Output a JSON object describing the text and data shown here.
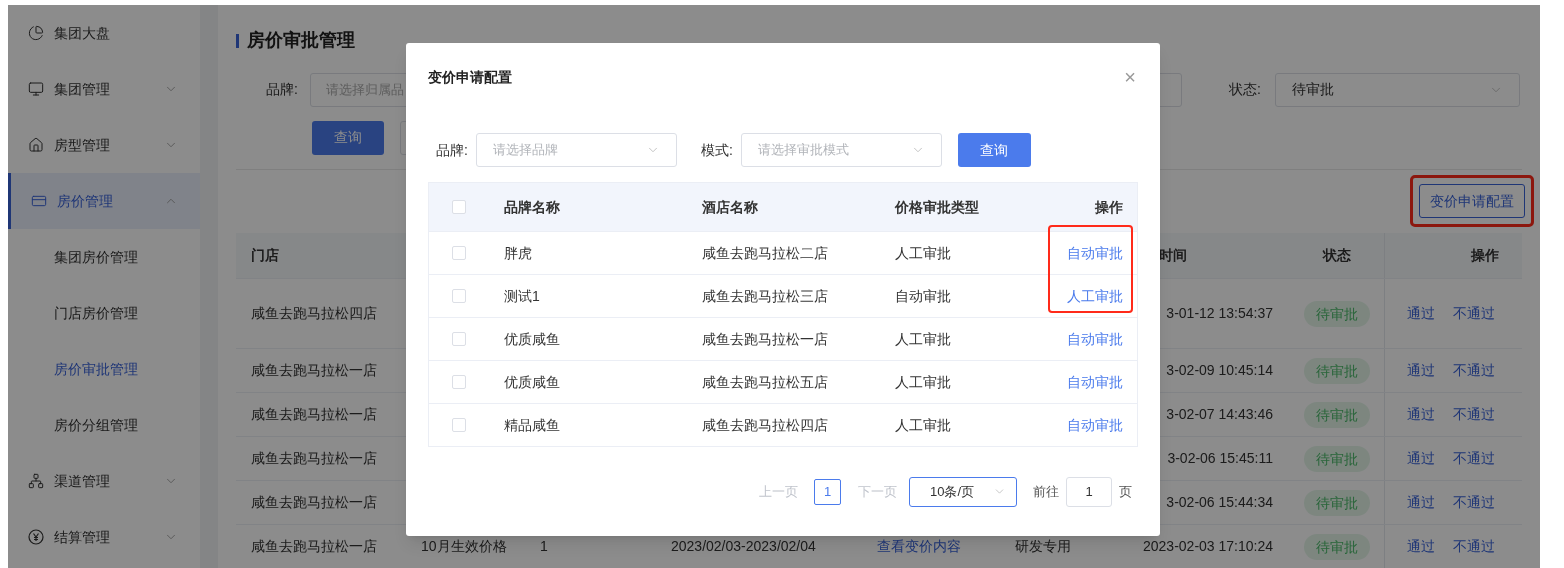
{
  "sidebar": {
    "items": [
      {
        "label": "集团大盘",
        "kind": "link",
        "selected": false
      },
      {
        "label": "集团管理",
        "kind": "group",
        "selected": false,
        "expanded": false
      },
      {
        "label": "房型管理",
        "kind": "group",
        "selected": false,
        "expanded": false
      },
      {
        "label": "房价管理",
        "kind": "group",
        "selected": true,
        "expanded": true,
        "children": [
          {
            "label": "集团房价管理",
            "selected": false
          },
          {
            "label": "门店房价管理",
            "selected": false
          },
          {
            "label": "房价审批管理",
            "selected": true
          },
          {
            "label": "房价分组管理",
            "selected": false
          }
        ]
      },
      {
        "label": "渠道管理",
        "kind": "group",
        "selected": false,
        "expanded": false
      },
      {
        "label": "结算管理",
        "kind": "group",
        "selected": false,
        "expanded": false
      }
    ]
  },
  "page": {
    "title": "房价审批管理",
    "filters": [
      {
        "label": "品牌:",
        "placeholder": "请选择归属品"
      },
      {
        "label": "状态:",
        "value": "待审批"
      }
    ],
    "query_button": "查询",
    "config_button": {
      "label": "变价申请配置",
      "highlighted": true
    },
    "table": {
      "columns": {
        "store": "门店",
        "time": "时间",
        "status": "状态",
        "actions": "操作"
      },
      "rows": [
        {
          "store": "咸鱼去跑马拉松四店",
          "time": "3-01-12 13:54:37",
          "status": "待审批",
          "actions": [
            "通过",
            "不通过"
          ]
        },
        {
          "store": "咸鱼去跑马拉松一店",
          "time": "3-02-09 10:45:14",
          "status": "待审批",
          "actions": [
            "通过",
            "不通过"
          ]
        },
        {
          "store": "咸鱼去跑马拉松一店",
          "time": "3-02-07 14:43:46",
          "status": "待审批",
          "actions": [
            "通过",
            "不通过"
          ]
        },
        {
          "store": "咸鱼去跑马拉松一店",
          "time": "3-02-06 15:45:11",
          "status": "待审批",
          "actions": [
            "通过",
            "不通过"
          ]
        },
        {
          "store": "咸鱼去跑马拉松一店",
          "time": "3-02-06 15:44:34",
          "status": "待审批",
          "actions": [
            "通过",
            "不通过"
          ]
        },
        {
          "store": "咸鱼去跑马拉松一店",
          "column_2": "10月生效价格",
          "column_3": "1",
          "column_4": "2023/02/03-2023/02/04",
          "column_5": "查看变价内容",
          "column_6": "研发专用",
          "time": "2023-02-03 17:10:24",
          "status": "待审批",
          "actions": [
            "通过",
            "不通过"
          ]
        }
      ]
    }
  },
  "dialog": {
    "title": "变价申请配置",
    "close": "×",
    "filters": [
      {
        "label": "品牌:",
        "placeholder": "请选择品牌"
      },
      {
        "label": "模式:",
        "placeholder": "请选择审批模式"
      }
    ],
    "query_button": "查询",
    "table": {
      "columns": [
        "品牌名称",
        "酒店名称",
        "价格审批类型",
        "操作"
      ],
      "header_checked": false,
      "rows": [
        {
          "checked": false,
          "brand": "胖虎",
          "hotel": "咸鱼去跑马拉松二店",
          "type": "人工审批",
          "action": "自动审批",
          "highlighted": true
        },
        {
          "checked": false,
          "brand": "测试1",
          "hotel": "咸鱼去跑马拉松三店",
          "type": "自动审批",
          "action": "人工审批",
          "highlighted": true
        },
        {
          "checked": false,
          "brand": "优质咸鱼",
          "hotel": "咸鱼去跑马拉松一店",
          "type": "人工审批",
          "action": "自动审批",
          "highlighted": false
        },
        {
          "checked": false,
          "brand": "优质咸鱼",
          "hotel": "咸鱼去跑马拉松五店",
          "type": "人工审批",
          "action": "自动审批",
          "highlighted": false
        },
        {
          "checked": false,
          "brand": "精品咸鱼",
          "hotel": "咸鱼去跑马拉松四店",
          "type": "人工审批",
          "action": "自动审批",
          "highlighted": false
        }
      ]
    },
    "pagination": {
      "prev": {
        "label": "上一页",
        "disabled": true
      },
      "pages": [
        {
          "label": "1",
          "selected": true
        }
      ],
      "next": {
        "label": "下一页",
        "disabled": true
      },
      "page_size": "10条/页",
      "goto_label": "前往",
      "goto_value": "1",
      "goto_suffix": "页"
    }
  }
}
